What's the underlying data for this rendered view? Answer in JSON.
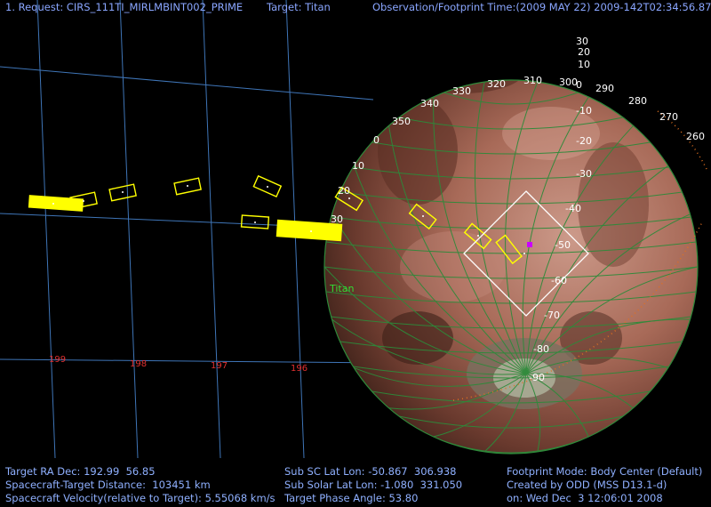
{
  "header": {
    "request": "1. Request: CIRS_111TI_MIRLMBINT002_PRIME",
    "target": "Target: Titan",
    "obs_time": "Observation/Footprint Time:(2009 MAY 22) 2009-142T02:34:56.87"
  },
  "planet": {
    "name": "Titan",
    "lat_labels": [
      {
        "text": "30"
      },
      {
        "text": "20"
      },
      {
        "text": "10"
      },
      {
        "text": "0"
      },
      {
        "text": "-10"
      },
      {
        "text": "-20"
      },
      {
        "text": "-30"
      },
      {
        "text": "-40"
      },
      {
        "text": "-50"
      },
      {
        "text": "-60"
      },
      {
        "text": "-70"
      },
      {
        "text": "-80"
      },
      {
        "text": "-90"
      }
    ],
    "lon_labels": [
      {
        "text": "350"
      },
      {
        "text": "340"
      },
      {
        "text": "330"
      },
      {
        "text": "320"
      },
      {
        "text": "310"
      },
      {
        "text": "300"
      },
      {
        "text": "290"
      },
      {
        "text": "280"
      },
      {
        "text": "270"
      },
      {
        "text": "260"
      },
      {
        "text": "0"
      },
      {
        "text": "10"
      },
      {
        "text": "20"
      },
      {
        "text": "30"
      }
    ]
  },
  "ra_labels": [
    "199",
    "198",
    "197",
    "196"
  ],
  "footer": {
    "left1": "Target RA Dec: 192.99  56.85",
    "left2": "Spacecraft-Target Distance:  103451 km",
    "left3": "Spacecraft Velocity(relative to Target): 5.55068 km/s",
    "mid1": "Sub SC Lat Lon: -50.867  306.938",
    "mid2": "Sub Solar Lat Lon: -1.080  331.050",
    "mid3": "Target Phase Angle: 53.80",
    "right1": "Footprint Mode: Body Center (Default)",
    "right2": "Created by ODD (MSS D13.1-d)",
    "right3": "on: Wed Dec  3 12:06:01 2008"
  },
  "colors": {
    "background": "#000000",
    "sky_grid": "#4a8ad8",
    "planet_grid": "#2e8a3a",
    "footprint": "#ffff00",
    "planet_label": "#33dd33",
    "ra_label": "#e23030",
    "terminator": "#e07020",
    "hud_text": "#8fb6ff"
  }
}
